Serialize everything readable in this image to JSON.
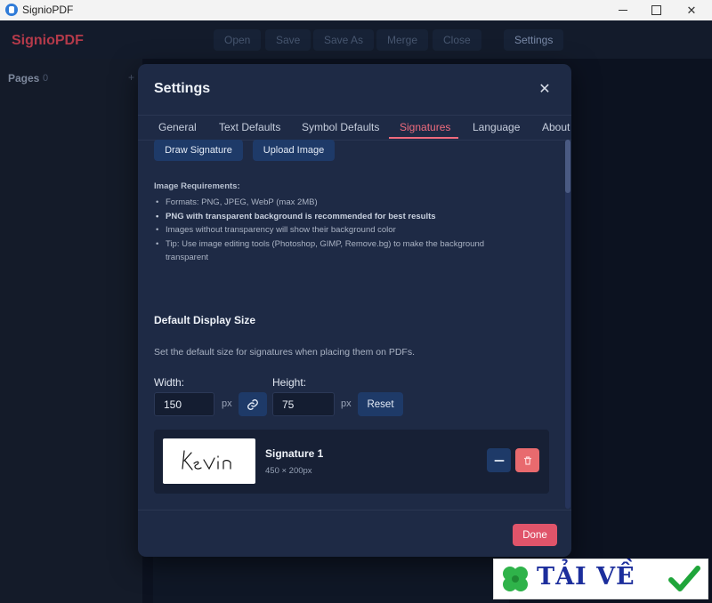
{
  "window": {
    "title": "SignioPDF",
    "controls": {
      "minimize": "—",
      "maximize": "☐",
      "close": "✕"
    }
  },
  "app": {
    "brand": "SignioPDF",
    "toolbar": [
      "Open",
      "Save",
      "Save As",
      "Merge",
      "Close",
      "Settings"
    ],
    "sidebar": {
      "pages_label": "Pages",
      "pages_count": "0",
      "add": "+"
    }
  },
  "modal": {
    "title": "Settings",
    "close": "✕",
    "tabs": [
      "General",
      "Text Defaults",
      "Symbol Defaults",
      "Signatures",
      "Language",
      "About"
    ],
    "active_tab": "Signatures",
    "buttons": {
      "draw": "Draw Signature",
      "upload": "Upload Image"
    },
    "requirements": {
      "title": "Image Requirements:",
      "items": [
        "Formats: PNG, JPEG, WebP (max 2MB)",
        "PNG with transparent background is recommended for best results",
        "Images without transparency will show their background color",
        "Tip: Use image editing tools (Photoshop, GIMP, Remove.bg) to make the background transparent"
      ]
    },
    "display_size": {
      "title": "Default Display Size",
      "description": "Set the default size for signatures when placing them on PDFs.",
      "width_label": "Width:",
      "width_value": "150",
      "height_label": "Height:",
      "height_value": "75",
      "unit": "px",
      "reset": "Reset"
    },
    "signature": {
      "name": "Signature 1",
      "dimensions": "450 × 200px",
      "handwriting": "Kevin"
    },
    "footer": {
      "done": "Done"
    }
  },
  "watermark": {
    "text": "TẢI VỀ"
  },
  "colors": {
    "accent": "#ef6b7d",
    "primary_button": "#1e3a68",
    "danger": "#e86a6e",
    "modal_bg": "#1e2a45"
  }
}
